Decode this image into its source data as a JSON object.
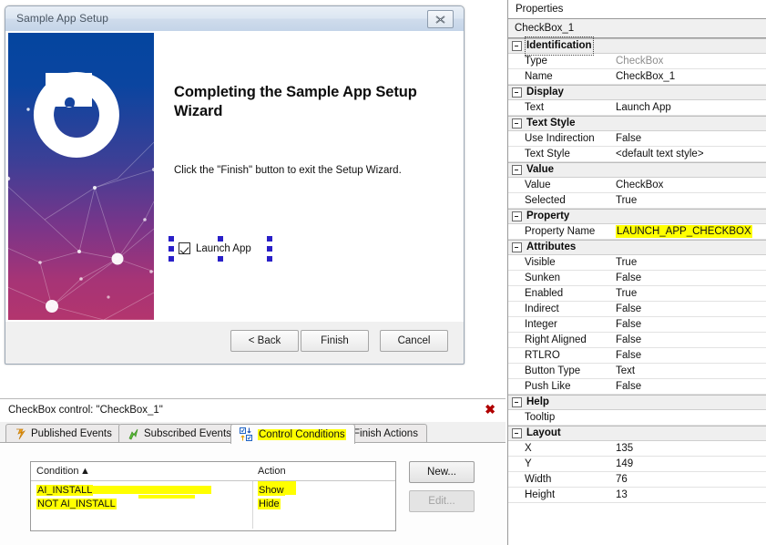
{
  "wizard": {
    "title": "Sample App Setup",
    "close_label": "✕",
    "heading": "Completing the Sample App Setup Wizard",
    "subtext": "Click the \"Finish\" button to exit the Setup Wizard.",
    "checkbox": {
      "label": "Launch App",
      "checked": true
    },
    "buttons": {
      "back": "< Back",
      "finish": "Finish",
      "cancel": "Cancel"
    },
    "banner_colors": {
      "top": "#04459f",
      "bottom": "#b3356e"
    }
  },
  "control_panel": {
    "title": "CheckBox control: \"CheckBox_1\"",
    "close_label": "✖",
    "tabs": [
      {
        "label": "Published Events",
        "icon": "orange-lightning-icon",
        "active": false
      },
      {
        "label": "Subscribed Events",
        "icon": "green-lightning-icon",
        "active": false
      },
      {
        "label": "Control Conditions",
        "icon": "checkbox-arrows-icon",
        "active": true,
        "highlighted": true
      },
      {
        "label": "Finish Actions",
        "icon": "green-play-icon",
        "active": false
      }
    ],
    "table": {
      "columns": [
        "Condition",
        "Action"
      ],
      "sort_indicator": "▲",
      "rows": [
        {
          "condition": "AI_INSTALL",
          "action": "Show"
        },
        {
          "condition": "NOT AI_INSTALL",
          "action": "Hide"
        }
      ]
    },
    "buttons": {
      "new": "New...",
      "edit": "Edit..."
    },
    "highlight_color": "#ffff00"
  },
  "properties": {
    "title": "Properties",
    "subject": "CheckBox_1",
    "groups": [
      {
        "label": "Identification",
        "focused": true,
        "rows": [
          {
            "key": "Type",
            "value": "CheckBox",
            "dim": true
          },
          {
            "key": "Name",
            "value": "CheckBox_1"
          }
        ]
      },
      {
        "label": "Display",
        "rows": [
          {
            "key": "Text",
            "value": "Launch App"
          }
        ]
      },
      {
        "label": "Text Style",
        "rows": [
          {
            "key": "Use Indirection",
            "value": "False"
          },
          {
            "key": "Text Style",
            "value": "<default text style>"
          }
        ]
      },
      {
        "label": "Value",
        "rows": [
          {
            "key": "Value",
            "value": "CheckBox"
          },
          {
            "key": "Selected",
            "value": "True"
          }
        ]
      },
      {
        "label": "Property",
        "rows": [
          {
            "key": "Property Name",
            "value": "LAUNCH_APP_CHECKBOX",
            "highlighted": true
          }
        ]
      },
      {
        "label": "Attributes",
        "rows": [
          {
            "key": "Visible",
            "value": "True"
          },
          {
            "key": "Sunken",
            "value": "False"
          },
          {
            "key": "Enabled",
            "value": "True"
          },
          {
            "key": "Indirect",
            "value": "False"
          },
          {
            "key": "Integer",
            "value": "False"
          },
          {
            "key": "Right Aligned",
            "value": "False"
          },
          {
            "key": "RTLRO",
            "value": "False"
          },
          {
            "key": "Button Type",
            "value": "Text"
          },
          {
            "key": "Push Like",
            "value": "False"
          }
        ]
      },
      {
        "label": "Help",
        "rows": [
          {
            "key": "Tooltip",
            "value": ""
          }
        ]
      },
      {
        "label": "Layout",
        "rows": [
          {
            "key": "X",
            "value": "135"
          },
          {
            "key": "Y",
            "value": "149"
          },
          {
            "key": "Width",
            "value": "76"
          },
          {
            "key": "Height",
            "value": "13"
          }
        ]
      }
    ]
  }
}
